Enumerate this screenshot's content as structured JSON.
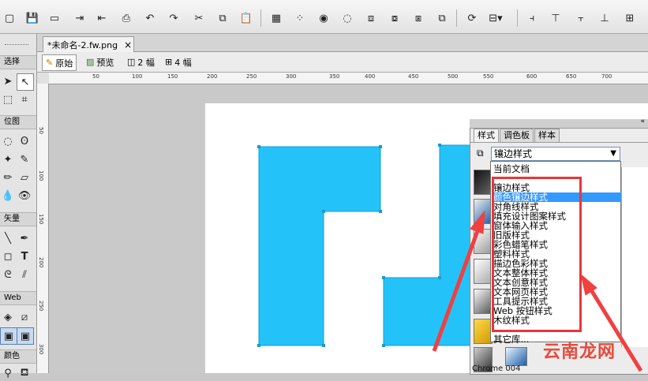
{
  "document": {
    "tab_title": "*未命名-2.fw.png",
    "close_label": "×"
  },
  "view_bar": {
    "original": "原始",
    "preview": "预览",
    "two_up": "2 幅",
    "four_up": "4 幅"
  },
  "tools": {
    "select_label": "选择",
    "bitmap_label": "位图",
    "vector_label": "矢量",
    "web_label": "Web",
    "color_label": "颜色"
  },
  "ruler": {
    "h_ticks": [
      "50",
      "100",
      "150",
      "200",
      "250",
      "300",
      "350",
      "400",
      "450",
      "500",
      "550",
      "600",
      "650",
      "700"
    ],
    "v_ticks": [
      "50",
      "100",
      "150",
      "200",
      "250",
      "300"
    ]
  },
  "panel": {
    "tabs": [
      "样式",
      "调色板",
      "样本"
    ],
    "selected_style": "镶边样式",
    "dropdown_items": [
      "当前文档",
      "",
      "镶边样式",
      "颜色镶边样式",
      "对角线样式",
      "填充设计图案样式",
      "窗体输入样式",
      "旧版样式",
      "彩色蜡笔样式",
      "塑料样式",
      "描边色彩样式",
      "文本整体样式",
      "文本创意样式",
      "文本网页样式",
      "工具提示样式",
      "Web 按钮样式",
      "木纹样式",
      "------------",
      "其它库..."
    ],
    "selected_index": 3,
    "footer": "Chrome 004"
  },
  "watermark": "云南龙网",
  "colors": {
    "shape_fill": "#23c3fa",
    "highlight_box": "#e8363a",
    "arrow": "#f04040",
    "selection": "#3399ff"
  }
}
